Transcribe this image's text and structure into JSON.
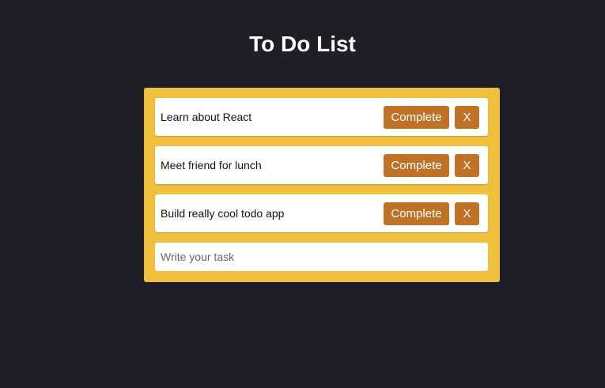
{
  "title": "To Do List",
  "colors": {
    "background": "#1e1f26",
    "panel": "#efc03e",
    "button": "#bf7126"
  },
  "todos": [
    {
      "text": "Learn about React",
      "complete_label": "Complete",
      "delete_label": "X"
    },
    {
      "text": "Meet friend for lunch",
      "complete_label": "Complete",
      "delete_label": "X"
    },
    {
      "text": "Build really cool todo app",
      "complete_label": "Complete",
      "delete_label": "X"
    }
  ],
  "input": {
    "value": "",
    "placeholder": "Write your task"
  }
}
